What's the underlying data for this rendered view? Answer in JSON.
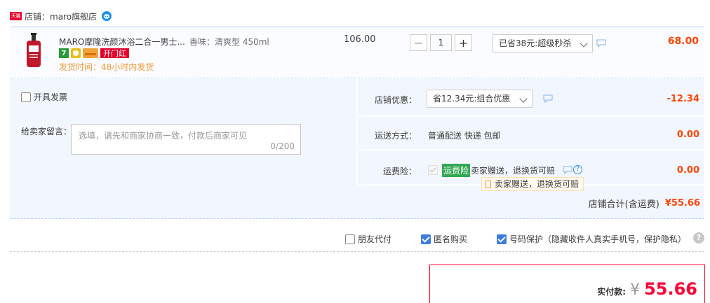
{
  "shop": {
    "badge": "天猫",
    "label": "店铺：maro旗舰店"
  },
  "item": {
    "title": "MARO摩隆洗颜沐浴二合一男士...",
    "sku": "香味：清爽型 450ml",
    "service_fapiao": "开门红",
    "ship_time": "发货时间：48小时内发货",
    "unit_price": "106.00",
    "quantity": "1",
    "promo": "已省38元:超级秒杀",
    "total": "68.00"
  },
  "invoice": {
    "label": "开具发票"
  },
  "note": {
    "label": "给卖家留言：",
    "placeholder": "选填，请先和商家协商一致，付款后商家可见",
    "count": "0/200"
  },
  "shop_discount": {
    "label": "店铺优惠：",
    "selected": "省12.34元:组合优惠",
    "amount": "-12.34"
  },
  "shipping": {
    "label": "运送方式：",
    "method": "普通配送 快递 包邮",
    "amount": "0.00"
  },
  "insurance": {
    "label": "运费险：",
    "tag": "运费险",
    "desc": "卖家赠送，退换货可赔",
    "tooltip": "卖家赠送，退换货可赔",
    "amount": "0.00"
  },
  "shop_total": {
    "label": "店铺合计(含运费)",
    "value": "¥55.66"
  },
  "options": {
    "friend_pay": "朋友代付",
    "anonymous": "匿名购买",
    "privacy": "号码保护（隐藏收件人真实手机号，保护隐私）",
    "help": "?"
  },
  "payment": {
    "label": "实付款:",
    "currency": "¥",
    "value": "55.66"
  },
  "colors": {
    "accent_red": "#ff0036",
    "price_orange": "#f40",
    "checkbox_blue": "#3a7de0",
    "insurance_green": "#34a853"
  }
}
